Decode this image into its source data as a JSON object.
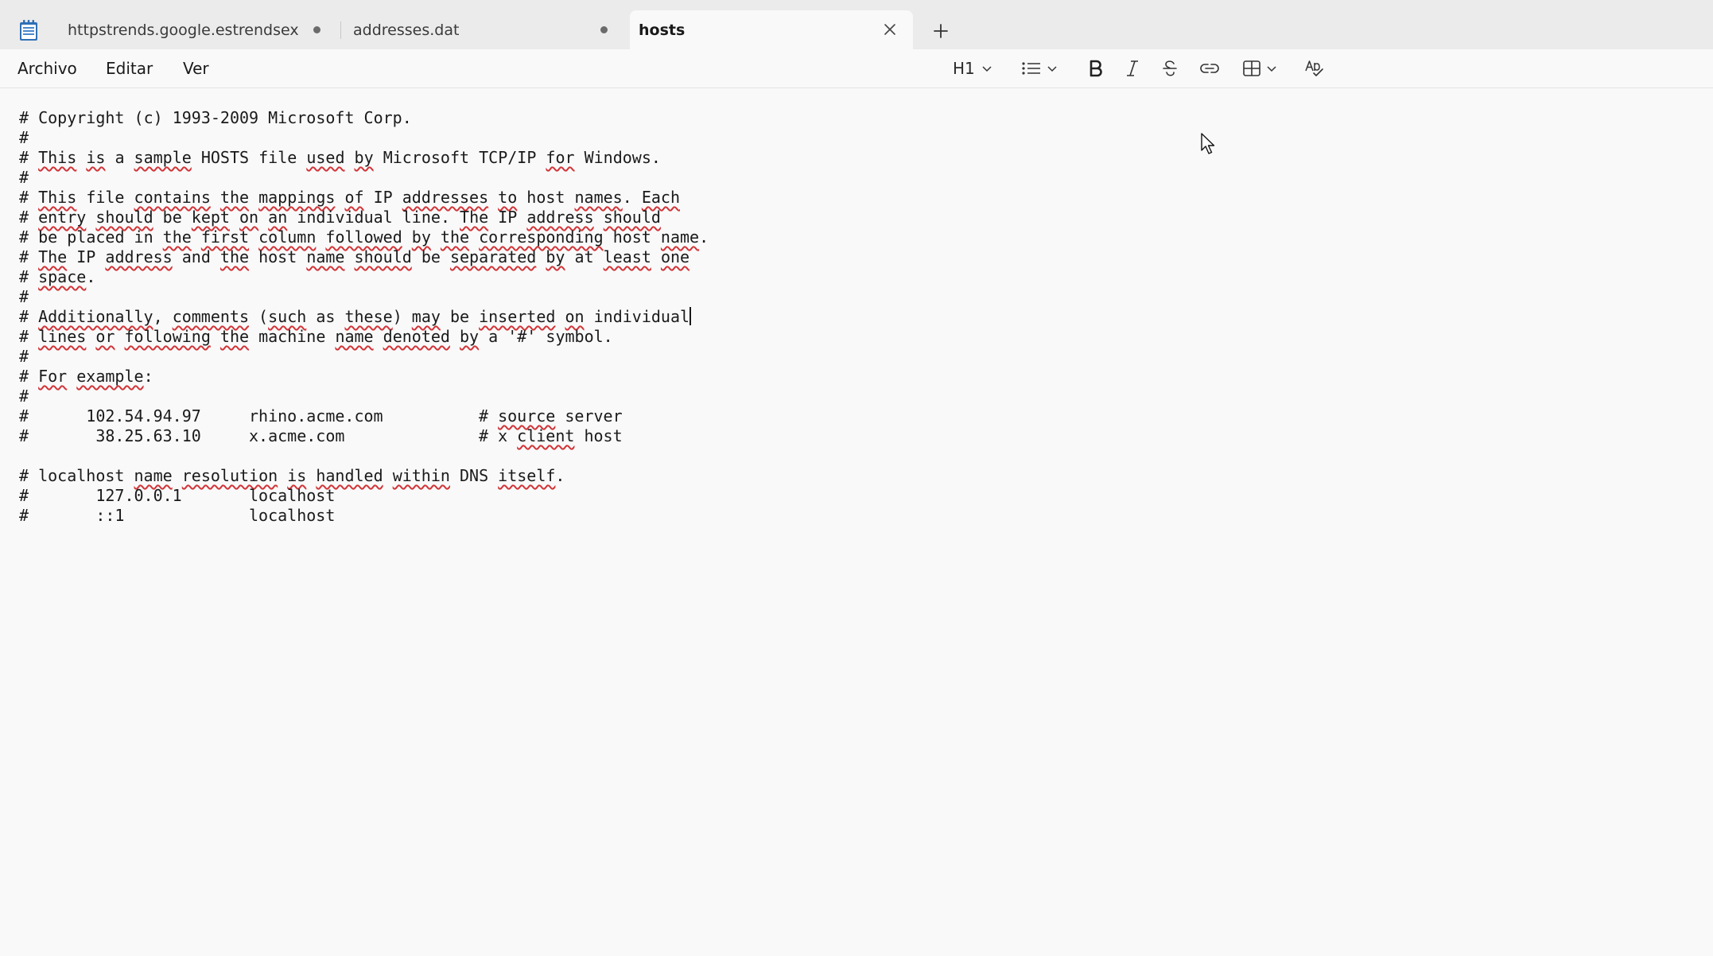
{
  "tabs": [
    {
      "label": "httpstrends.google.estrendsexplore",
      "unsaved": true,
      "active": false
    },
    {
      "label": "addresses.dat",
      "unsaved": true,
      "active": false
    },
    {
      "label": "hosts",
      "unsaved": false,
      "active": true
    }
  ],
  "icons": {
    "app": "notepad-icon",
    "close": "close-icon",
    "new_tab": "plus-icon",
    "heading_dropdown": "chevron-down-icon",
    "list": "bulleted-list-icon",
    "bold": "bold-icon",
    "italic": "italic-icon",
    "strikethrough": "strikethrough-icon",
    "link": "link-icon",
    "table": "table-icon",
    "spellcheck": "spellcheck-icon"
  },
  "menu": {
    "file": "Archivo",
    "edit": "Editar",
    "view": "Ver"
  },
  "toolbar": {
    "heading_label": "H1"
  },
  "document": {
    "lines": [
      "# Copyright (c) 1993-2009 Microsoft Corp.",
      "#",
      "# This is a sample HOSTS file used by Microsoft TCP/IP for Windows.",
      "#",
      "# This file contains the mappings of IP addresses to host names. Each",
      "# entry should be kept on an individual line. The IP address should",
      "# be placed in the first column followed by the corresponding host name.",
      "# The IP address and the host name should be separated by at least one",
      "# space.",
      "#",
      "# Additionally, comments (such as these) may be inserted on individual",
      "# lines or following the machine name denoted by a '#' symbol.",
      "#",
      "# For example:",
      "#",
      "#      102.54.94.97     rhino.acme.com          # source server",
      "#       38.25.63.10     x.acme.com              # x client host",
      "",
      "# localhost name resolution is handled within DNS itself.",
      "#       127.0.0.1       localhost",
      "#       ::1             localhost"
    ],
    "caret_line": 10,
    "spell_flagged": [
      [],
      [],
      [
        "This",
        "is",
        "sample",
        "used",
        "by",
        "for"
      ],
      [],
      [
        "This",
        "contains",
        "the",
        "mappings",
        "of",
        "addresses",
        "to",
        "names",
        "Each"
      ],
      [
        "entry",
        "should",
        "kept",
        "on",
        "an",
        "The",
        "address",
        "should"
      ],
      [
        "the",
        "first",
        "column",
        "followed",
        "by",
        "the",
        "corresponding",
        "name"
      ],
      [
        "The",
        "address",
        "the",
        "name",
        "should",
        "separated",
        "by",
        "least",
        "one"
      ],
      [
        "space"
      ],
      [],
      [
        "Additionally",
        "comments",
        "such",
        "these",
        "may",
        "inserted",
        "on"
      ],
      [
        "lines",
        "or",
        "following",
        "the",
        "name",
        "denoted",
        "by"
      ],
      [],
      [
        "For",
        "example"
      ],
      [],
      [
        "source"
      ],
      [
        "client"
      ],
      [],
      [
        "name",
        "resolution",
        "is",
        "handled",
        "within",
        "itself"
      ],
      [],
      []
    ]
  }
}
